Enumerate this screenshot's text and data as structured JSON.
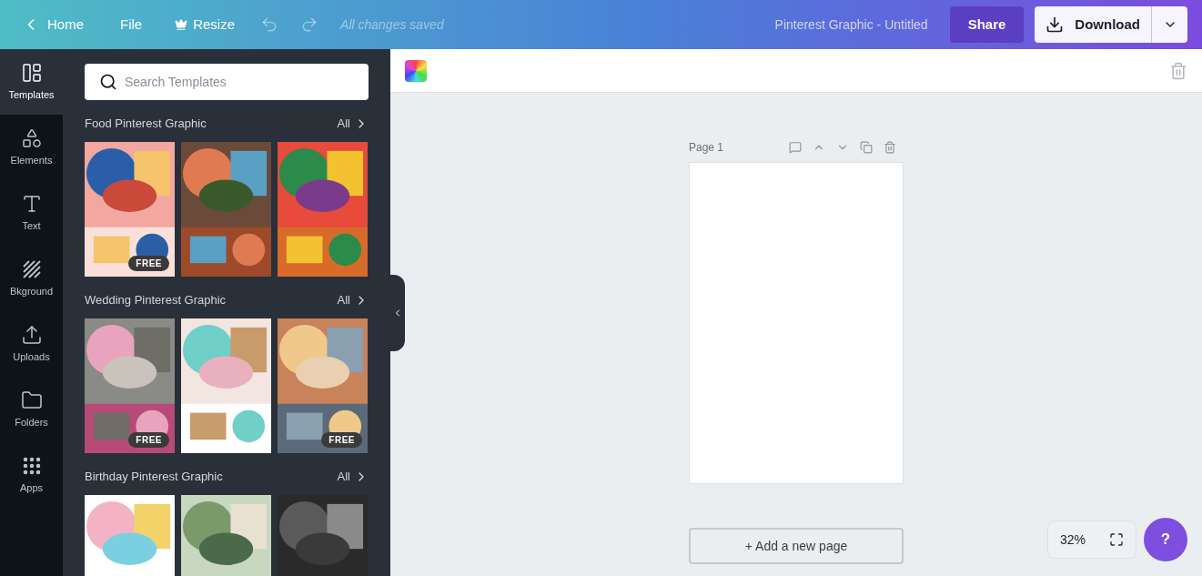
{
  "topbar": {
    "home": "Home",
    "file": "File",
    "resize": "Resize",
    "status": "All changes saved",
    "doc_title": "Pinterest Graphic - Untitled",
    "share": "Share",
    "download": "Download"
  },
  "sidebar": {
    "items": [
      {
        "kind": "templates",
        "label": "Templates",
        "selected": true
      },
      {
        "kind": "elements",
        "label": "Elements",
        "selected": false
      },
      {
        "kind": "text",
        "label": "Text",
        "selected": false
      },
      {
        "kind": "background",
        "label": "Bkground",
        "selected": false
      },
      {
        "kind": "uploads",
        "label": "Uploads",
        "selected": false
      },
      {
        "kind": "folders",
        "label": "Folders",
        "selected": false
      },
      {
        "kind": "apps",
        "label": "Apps",
        "selected": false
      }
    ]
  },
  "panel": {
    "search": {
      "placeholder": "Search Templates"
    },
    "sections": [
      {
        "title": "Food Pinterest Graphic",
        "all": "All",
        "templates": [
          {
            "kind": "picture",
            "badge": "FREE"
          },
          {
            "kind": "picture"
          },
          {
            "kind": "picture"
          }
        ]
      },
      {
        "title": "Wedding Pinterest Graphic",
        "all": "All",
        "templates": [
          {
            "kind": "picture",
            "badge": "FREE"
          },
          {
            "kind": "picture"
          },
          {
            "kind": "picture",
            "badge": "FREE"
          }
        ]
      },
      {
        "title": "Birthday Pinterest Graphic",
        "all": "All",
        "templates": [
          {
            "kind": "picture"
          },
          {
            "kind": "picture"
          },
          {
            "kind": "picture"
          }
        ]
      }
    ]
  },
  "canvas": {
    "page_label": "Page 1",
    "add_page": "+ Add a new page",
    "zoom": "32%",
    "help": "?"
  }
}
